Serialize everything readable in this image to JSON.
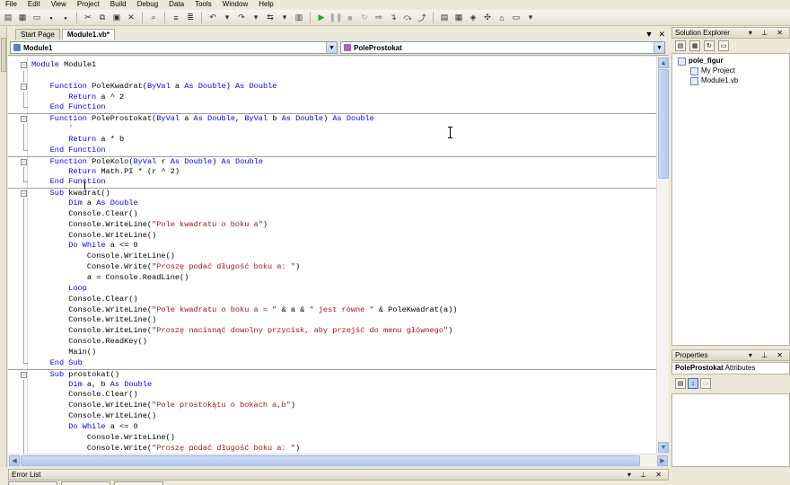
{
  "menu": [
    "File",
    "Edit",
    "View",
    "Project",
    "Build",
    "Debug",
    "Data",
    "Tools",
    "Window",
    "Help"
  ],
  "tabs": [
    {
      "label": "Start Page",
      "active": false
    },
    {
      "label": "Module1.vb*",
      "active": true
    }
  ],
  "tab_controls": {
    "dropdown": "▼",
    "close": "✕"
  },
  "navbar": {
    "left_combo": "Module1",
    "right_combo": "PoleProstokat"
  },
  "code_lines": [
    "Module Module1",
    "",
    "    Function PoleKwadrat(ByVal a As Double) As Double",
    "        Return a ^ 2",
    "    End Function",
    "    Function PoleProstokat(ByVal a As Double, ByVal b As Double) As Double",
    "        '",
    "        Return a * b",
    "    End Function",
    "    Function PoleKolo(ByVal r As Double) As Double",
    "        Return Math.PI * (r ^ 2)",
    "    End Function",
    "    Sub kwadrat()",
    "        Dim a As Double",
    "        Console.Clear()",
    "        Console.WriteLine(\"Pole kwadratu o boku a\")",
    "        Console.WriteLine()",
    "        Do While a <= 0",
    "            Console.WriteLine()",
    "            Console.Write(\"Proszę podać długość boku a: \")",
    "            a = Console.ReadLine()",
    "        Loop",
    "        Console.Clear()",
    "        Console.WriteLine(\"Pole kwadratu o boku a = \" & a & \" jest równe \" & PoleKwadrat(a))",
    "        Console.WriteLine()",
    "        Console.WriteLine(\"Proszę nacisnąć dowolny przycisk, aby przejść do menu głównego\")",
    "        Console.ReadKey()",
    "        Main()",
    "    End Sub",
    "    Sub prostokat()",
    "        Dim a, b As Double",
    "        Console.Clear()",
    "        Console.WriteLine(\"Pole prostokątu o bokach a,b\")",
    "        Console.WriteLine()",
    "        Do While a <= 0",
    "            Console.WriteLine()",
    "            Console.Write(\"Proszę podać długość boku a: \")"
  ],
  "solution_explorer": {
    "title": "Solution Explorer",
    "controls": "▾ ⊥ ✕",
    "project": "pole_figur",
    "items": [
      "My Project",
      "Module1.vb"
    ]
  },
  "properties": {
    "title": "Properties",
    "controls": "▾ ⊥ ✕",
    "object_name": "PoleProstokat",
    "object_type": "Attributes"
  },
  "error_list": {
    "title": "Error List",
    "controls": "▾ ⊥ ✕"
  },
  "colors": {
    "keyword": "#0000ff",
    "string": "#a31515",
    "accent": "#316ac5"
  }
}
